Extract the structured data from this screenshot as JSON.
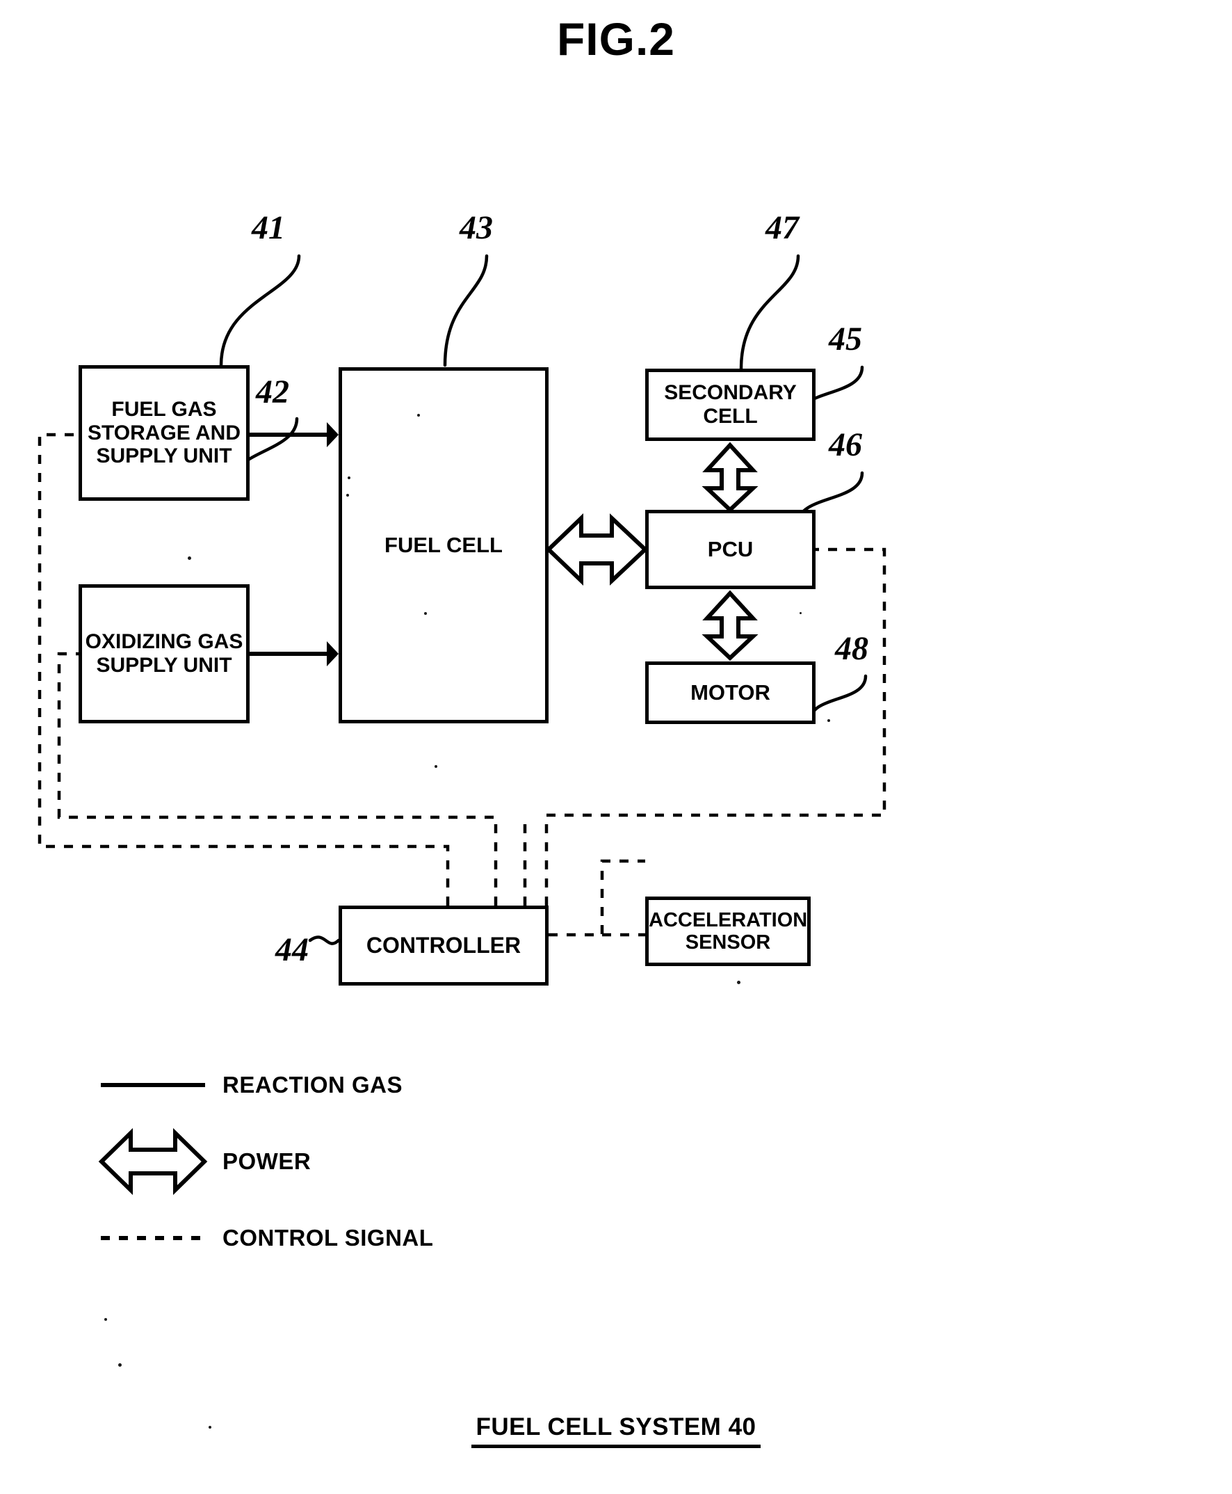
{
  "figure": {
    "title": "FIG.2",
    "caption": "FUEL CELL SYSTEM 40"
  },
  "blocks": [
    {
      "id": "fuel-gas-storage-and-supply-unit",
      "label": "FUEL GAS\nSTORAGE AND\nSUPPLY UNIT",
      "ref": "41"
    },
    {
      "id": "oxidizing-gas-supply-unit",
      "label": "OXIDIZING GAS\nSUPPLY UNIT",
      "ref": "42"
    },
    {
      "id": "fuel-cell",
      "label": "FUEL CELL",
      "ref": "43"
    },
    {
      "id": "controller",
      "label": "CONTROLLER",
      "ref": "44"
    },
    {
      "id": "pcu",
      "label": "PCU",
      "ref": "45"
    },
    {
      "id": "motor",
      "label": "MOTOR",
      "ref": "46"
    },
    {
      "id": "secondary-cell",
      "label": "SECONDARY\nCELL",
      "ref": "47"
    },
    {
      "id": "acceleration-sensor",
      "label": "ACCELERATION\nSENSOR",
      "ref": "48"
    }
  ],
  "labels": {
    "fuel_gas_line1": "FUEL GAS",
    "fuel_gas_line2": "STORAGE AND",
    "fuel_gas_line3": "SUPPLY UNIT",
    "oxidizing_line1": "OXIDIZING GAS",
    "oxidizing_line2": "SUPPLY UNIT",
    "fuel_cell": "FUEL CELL",
    "secondary_line1": "SECONDARY",
    "secondary_line2": "CELL",
    "pcu": "PCU",
    "motor": "MOTOR",
    "controller": "CONTROLLER",
    "accel_line1": "ACCELERATION",
    "accel_line2": "SENSOR"
  },
  "refs": {
    "r41": "41",
    "r42": "42",
    "r43": "43",
    "r44": "44",
    "r45": "45",
    "r46": "46",
    "r47": "47",
    "r48": "48"
  },
  "legend": {
    "items": [
      {
        "symbol": "solid-line",
        "label": "REACTION GAS"
      },
      {
        "symbol": "double-headed-arrow",
        "label": "POWER"
      },
      {
        "symbol": "dashed-line",
        "label": "CONTROL SIGNAL"
      }
    ],
    "reaction_gas": "REACTION GAS",
    "power": "POWER",
    "control_signal": "CONTROL SIGNAL"
  },
  "colors": {
    "ink": "#000000",
    "paper": "#ffffff"
  }
}
